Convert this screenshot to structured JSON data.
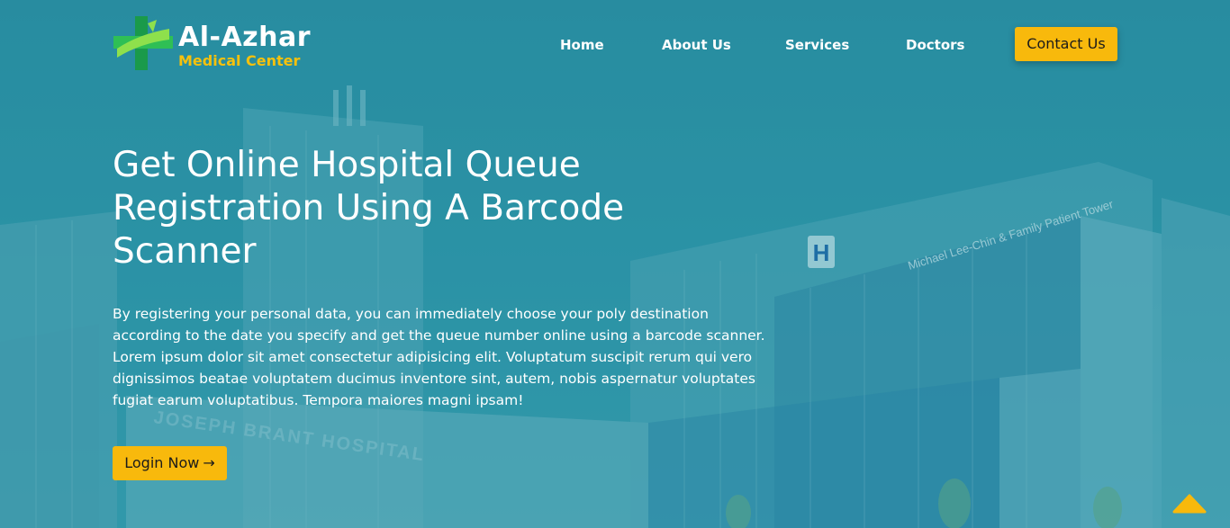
{
  "brand": {
    "name": "Al-Azhar",
    "subtitle": "Medical Center",
    "accent_color": "#f8b90c",
    "logo_icon": "medical-cross-logo"
  },
  "nav": {
    "items": [
      {
        "label": "Home"
      },
      {
        "label": "About Us"
      },
      {
        "label": "Services"
      },
      {
        "label": "Doctors"
      }
    ],
    "contact_label": "Contact Us"
  },
  "hero": {
    "title": "Get Online Hospital Queue Registration Using A Barcode Scanner",
    "description": "By registering your personal data, you can immediately choose your poly destination according to the date you specify and get the queue number online using a barcode scanner. Lorem ipsum dolor sit amet consectetur adipisicing elit. Voluptatum suscipit rerum qui vero dignissimos beatae voluptatem ducimus inventore sint, autem, nobis aspernatur voluptates fugiat earum voluptatibus. Tempora maiores magni ipsam!",
    "cta_label": "Login Now",
    "cta_icon": "arrow-right-icon"
  },
  "building_signs": {
    "tower_sign": "Michael Lee-Chin & Family Patient Tower",
    "hospital_sign": "JOSEPH BRANT HOSPITAL",
    "h_sign": "H"
  },
  "scroll_top": {
    "icon": "chevron-up-icon"
  },
  "colors": {
    "overlay": "#2f8fa3",
    "text": "#ffffff"
  }
}
